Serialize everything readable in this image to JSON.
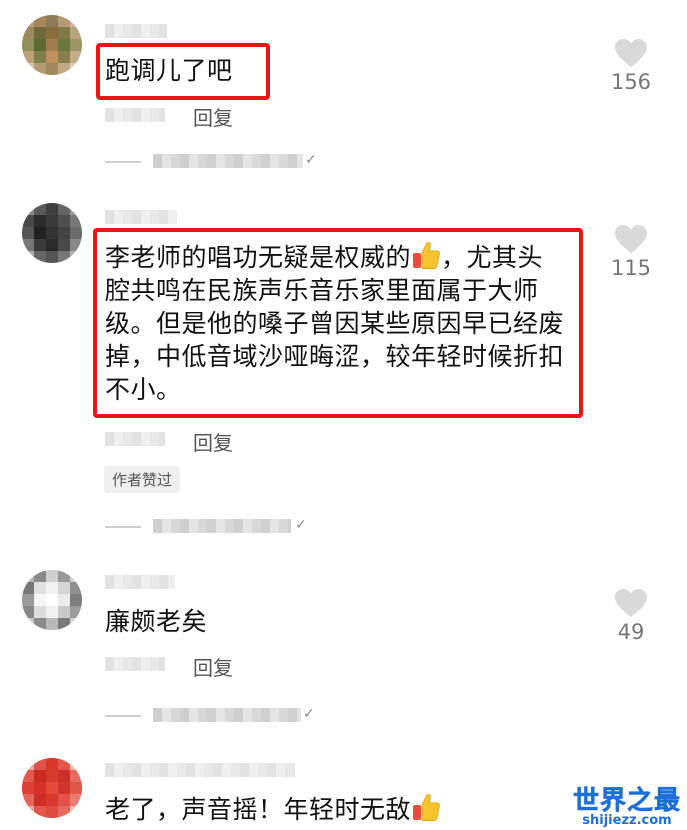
{
  "colors": {
    "highlight_border": "#e8151b",
    "heart": "#d9d9d9",
    "watermark": "#1d6fd6"
  },
  "comments": [
    {
      "text_lines": [
        "跑调儿了吧"
      ],
      "reply_label": "回复",
      "likes": "156",
      "highlighted": true
    },
    {
      "text_lines": [
        "李老师的唱功无疑是权威的",
        "，尤其头",
        "腔共鸣在民族声乐音乐家里面属于大师",
        "级。但是他的嗓子曾因某些原因早已经废",
        "掉，中低音域沙哑晦涩，较年轻时候折扣",
        "不小。"
      ],
      "reply_label": "回复",
      "likes": "115",
      "author_tag": "作者赞过",
      "highlighted": true
    },
    {
      "text_lines": [
        "廉颇老矣"
      ],
      "reply_label": "回复",
      "likes": "49",
      "highlighted": false
    },
    {
      "text_lines": [
        "老了，声音摇！年轻时无敌"
      ],
      "highlighted": false
    }
  ],
  "icons": {
    "like": "heart-icon",
    "thumbs_up_emoji": "thumbs-up-emoji-icon",
    "expand": "chevron-down-icon"
  },
  "watermark": {
    "title": "世界之最",
    "url": "shijiezz.com"
  }
}
